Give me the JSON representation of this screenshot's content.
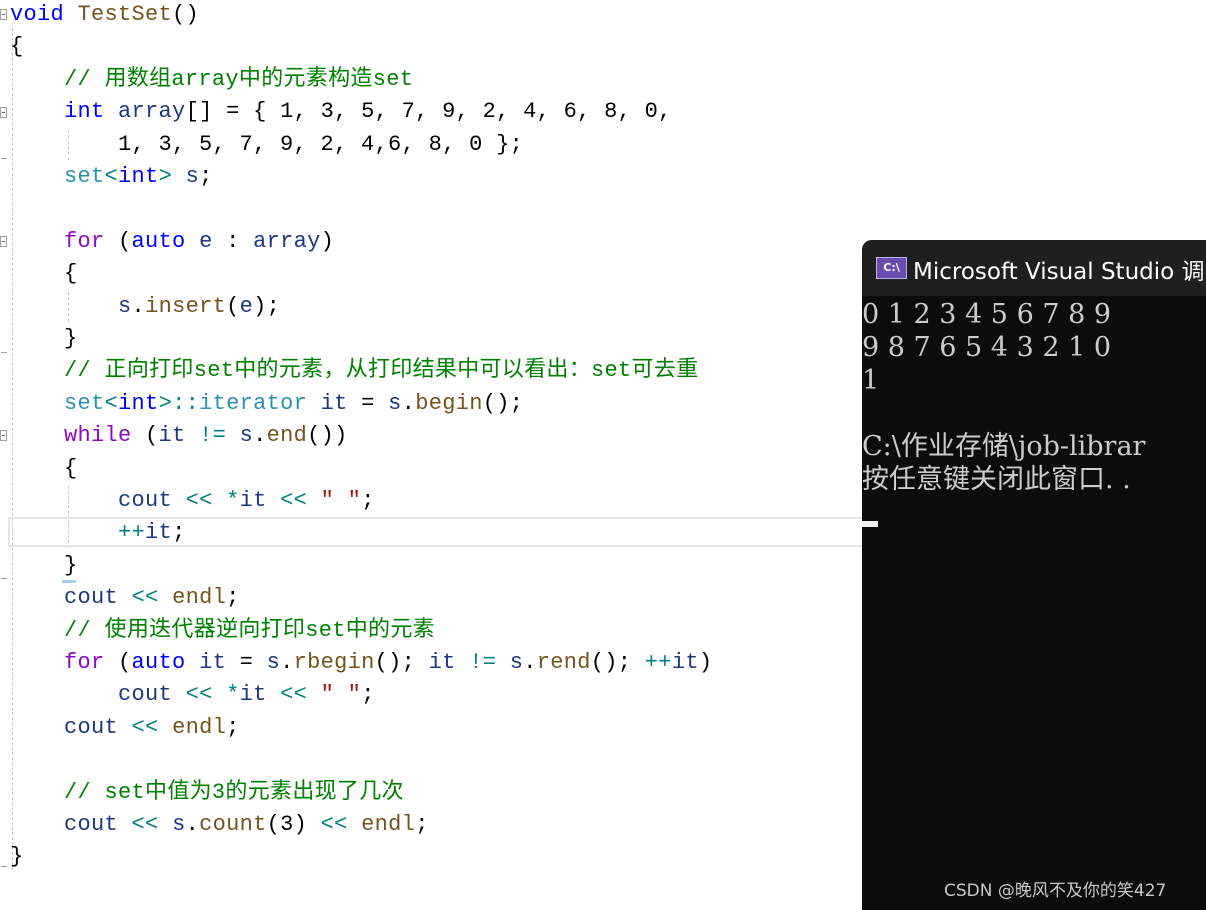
{
  "editor": {
    "lines": [
      {
        "segments": [
          {
            "t": "void",
            "c": "kw"
          },
          {
            "t": " ",
            "c": ""
          },
          {
            "t": "TestSet",
            "c": "fn"
          },
          {
            "t": "()",
            "c": ""
          }
        ]
      },
      {
        "segments": [
          {
            "t": "{",
            "c": ""
          }
        ]
      },
      {
        "segments": [
          {
            "t": "    // 用数组array中的元素构造set",
            "c": "cm"
          }
        ]
      },
      {
        "segments": [
          {
            "t": "    ",
            "c": ""
          },
          {
            "t": "int",
            "c": "kw"
          },
          {
            "t": " ",
            "c": ""
          },
          {
            "t": "array",
            "c": "vr"
          },
          {
            "t": "[] = { 1, 3, 5, 7, 9, 2, 4, 6, 8, 0,",
            "c": ""
          }
        ]
      },
      {
        "segments": [
          {
            "t": "        1, 3, 5, 7, 9, 2, 4,6, 8, 0 };",
            "c": ""
          }
        ]
      },
      {
        "segments": [
          {
            "t": "    ",
            "c": ""
          },
          {
            "t": "set",
            "c": "ty"
          },
          {
            "t": "<",
            "c": "op"
          },
          {
            "t": "int",
            "c": "kw"
          },
          {
            "t": ">",
            "c": "op"
          },
          {
            "t": " ",
            "c": ""
          },
          {
            "t": "s",
            "c": "vr"
          },
          {
            "t": ";",
            "c": ""
          }
        ]
      },
      {
        "segments": [
          {
            "t": "",
            "c": ""
          }
        ]
      },
      {
        "segments": [
          {
            "t": "    ",
            "c": ""
          },
          {
            "t": "for",
            "c": "kw2"
          },
          {
            "t": " (",
            "c": ""
          },
          {
            "t": "auto",
            "c": "kw"
          },
          {
            "t": " ",
            "c": ""
          },
          {
            "t": "e",
            "c": "vr"
          },
          {
            "t": " : ",
            "c": ""
          },
          {
            "t": "array",
            "c": "vr"
          },
          {
            "t": ")",
            "c": ""
          }
        ]
      },
      {
        "segments": [
          {
            "t": "    {",
            "c": ""
          }
        ]
      },
      {
        "segments": [
          {
            "t": "        ",
            "c": ""
          },
          {
            "t": "s",
            "c": "vr"
          },
          {
            "t": ".",
            "c": ""
          },
          {
            "t": "insert",
            "c": "fn"
          },
          {
            "t": "(",
            "c": ""
          },
          {
            "t": "e",
            "c": "vr"
          },
          {
            "t": ");",
            "c": ""
          }
        ]
      },
      {
        "segments": [
          {
            "t": "    }",
            "c": ""
          }
        ]
      },
      {
        "segments": [
          {
            "t": "    // 正向打印set中的元素，从打印结果中可以看出：set可去重",
            "c": "cm"
          }
        ]
      },
      {
        "segments": [
          {
            "t": "    ",
            "c": ""
          },
          {
            "t": "set",
            "c": "ty"
          },
          {
            "t": "<",
            "c": "op"
          },
          {
            "t": "int",
            "c": "kw"
          },
          {
            "t": ">::",
            "c": "op"
          },
          {
            "t": "iterator",
            "c": "ty"
          },
          {
            "t": " ",
            "c": ""
          },
          {
            "t": "it",
            "c": "vr"
          },
          {
            "t": " = ",
            "c": ""
          },
          {
            "t": "s",
            "c": "vr"
          },
          {
            "t": ".",
            "c": ""
          },
          {
            "t": "begin",
            "c": "fn"
          },
          {
            "t": "();",
            "c": ""
          }
        ]
      },
      {
        "segments": [
          {
            "t": "    ",
            "c": ""
          },
          {
            "t": "while",
            "c": "kw2"
          },
          {
            "t": " (",
            "c": ""
          },
          {
            "t": "it",
            "c": "vr"
          },
          {
            "t": " ",
            "c": ""
          },
          {
            "t": "!=",
            "c": "op"
          },
          {
            "t": " ",
            "c": ""
          },
          {
            "t": "s",
            "c": "vr"
          },
          {
            "t": ".",
            "c": ""
          },
          {
            "t": "end",
            "c": "fn"
          },
          {
            "t": "())",
            "c": ""
          }
        ]
      },
      {
        "segments": [
          {
            "t": "    {",
            "c": ""
          }
        ]
      },
      {
        "segments": [
          {
            "t": "        ",
            "c": ""
          },
          {
            "t": "cout",
            "c": "vr"
          },
          {
            "t": " ",
            "c": ""
          },
          {
            "t": "<<",
            "c": "op"
          },
          {
            "t": " ",
            "c": ""
          },
          {
            "t": "*",
            "c": "op"
          },
          {
            "t": "it",
            "c": "vr"
          },
          {
            "t": " ",
            "c": ""
          },
          {
            "t": "<<",
            "c": "op"
          },
          {
            "t": " ",
            "c": ""
          },
          {
            "t": "\" \"",
            "c": "st"
          },
          {
            "t": ";",
            "c": ""
          }
        ]
      },
      {
        "segments": [
          {
            "t": "        ",
            "c": ""
          },
          {
            "t": "++",
            "c": "op"
          },
          {
            "t": "it",
            "c": "vr"
          },
          {
            "t": ";",
            "c": ""
          }
        ]
      },
      {
        "segments": [
          {
            "t": "    }",
            "c": ""
          }
        ]
      },
      {
        "segments": [
          {
            "t": "    ",
            "c": ""
          },
          {
            "t": "cout",
            "c": "vr"
          },
          {
            "t": " ",
            "c": ""
          },
          {
            "t": "<<",
            "c": "op"
          },
          {
            "t": " ",
            "c": ""
          },
          {
            "t": "endl",
            "c": "fn"
          },
          {
            "t": ";",
            "c": ""
          }
        ]
      },
      {
        "segments": [
          {
            "t": "    // 使用迭代器逆向打印set中的元素",
            "c": "cm"
          }
        ]
      },
      {
        "segments": [
          {
            "t": "    ",
            "c": ""
          },
          {
            "t": "for",
            "c": "kw2"
          },
          {
            "t": " (",
            "c": ""
          },
          {
            "t": "auto",
            "c": "kw"
          },
          {
            "t": " ",
            "c": ""
          },
          {
            "t": "it",
            "c": "vr"
          },
          {
            "t": " = ",
            "c": ""
          },
          {
            "t": "s",
            "c": "vr"
          },
          {
            "t": ".",
            "c": ""
          },
          {
            "t": "rbegin",
            "c": "fn"
          },
          {
            "t": "(); ",
            "c": ""
          },
          {
            "t": "it",
            "c": "vr"
          },
          {
            "t": " ",
            "c": ""
          },
          {
            "t": "!=",
            "c": "op"
          },
          {
            "t": " ",
            "c": ""
          },
          {
            "t": "s",
            "c": "vr"
          },
          {
            "t": ".",
            "c": ""
          },
          {
            "t": "rend",
            "c": "fn"
          },
          {
            "t": "(); ",
            "c": ""
          },
          {
            "t": "++",
            "c": "op"
          },
          {
            "t": "it",
            "c": "vr"
          },
          {
            "t": ")",
            "c": ""
          }
        ]
      },
      {
        "segments": [
          {
            "t": "        ",
            "c": ""
          },
          {
            "t": "cout",
            "c": "vr"
          },
          {
            "t": " ",
            "c": ""
          },
          {
            "t": "<<",
            "c": "op"
          },
          {
            "t": " ",
            "c": ""
          },
          {
            "t": "*",
            "c": "op"
          },
          {
            "t": "it",
            "c": "vr"
          },
          {
            "t": " ",
            "c": ""
          },
          {
            "t": "<<",
            "c": "op"
          },
          {
            "t": " ",
            "c": ""
          },
          {
            "t": "\" \"",
            "c": "st"
          },
          {
            "t": ";",
            "c": ""
          }
        ]
      },
      {
        "segments": [
          {
            "t": "    ",
            "c": ""
          },
          {
            "t": "cout",
            "c": "vr"
          },
          {
            "t": " ",
            "c": ""
          },
          {
            "t": "<<",
            "c": "op"
          },
          {
            "t": " ",
            "c": ""
          },
          {
            "t": "endl",
            "c": "fn"
          },
          {
            "t": ";",
            "c": ""
          }
        ]
      },
      {
        "segments": [
          {
            "t": "",
            "c": ""
          }
        ]
      },
      {
        "segments": [
          {
            "t": "    // set中值为3的元素出现了几次",
            "c": "cm"
          }
        ]
      },
      {
        "segments": [
          {
            "t": "    ",
            "c": ""
          },
          {
            "t": "cout",
            "c": "vr"
          },
          {
            "t": " ",
            "c": ""
          },
          {
            "t": "<<",
            "c": "op"
          },
          {
            "t": " ",
            "c": ""
          },
          {
            "t": "s",
            "c": "vr"
          },
          {
            "t": ".",
            "c": ""
          },
          {
            "t": "count",
            "c": "fn"
          },
          {
            "t": "(3) ",
            "c": ""
          },
          {
            "t": "<<",
            "c": "op"
          },
          {
            "t": " ",
            "c": ""
          },
          {
            "t": "endl",
            "c": "fn"
          },
          {
            "t": ";",
            "c": ""
          }
        ]
      },
      {
        "segments": [
          {
            "t": "}",
            "c": ""
          }
        ]
      }
    ]
  },
  "console": {
    "title": "Microsoft Visual Studio 调",
    "icon_label": "C:\\",
    "output": [
      "0 1 2 3 4 5 6 7 8 9",
      "9 8 7 6 5 4 3 2 1 0",
      "1",
      "",
      "C:\\作业存储\\job-librar",
      "按任意键关闭此窗口. ."
    ]
  },
  "watermark": "CSDN @晚风不及你的笑427"
}
